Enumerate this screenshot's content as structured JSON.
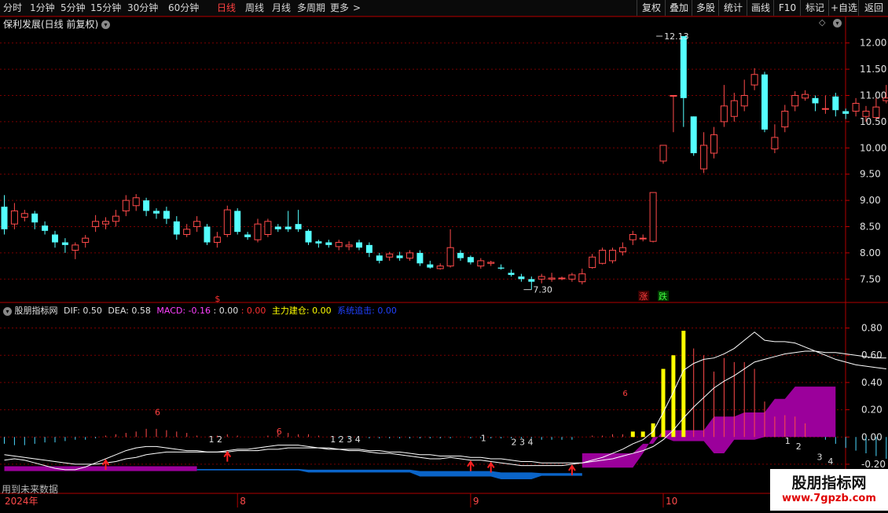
{
  "toolbar": {
    "periods": [
      "分时",
      "1分钟",
      "5分钟",
      "15分钟",
      "30分钟",
      "60分钟",
      "日线",
      "周线",
      "月线",
      "多周期",
      "更多"
    ],
    "active_period": "日线",
    "more_arrow": ">",
    "right_buttons": [
      "复权",
      "叠加",
      "多股",
      "统计",
      "画线",
      "F10",
      "标记",
      "+自选",
      "返回"
    ]
  },
  "main_panel": {
    "title": "保利发展(日线 前复权)",
    "diamond_icon": "◇",
    "high_label": "12.13",
    "low_label": "7.30",
    "signal_s": "$",
    "tag_rise": "涨",
    "tag_fall": "跌"
  },
  "indicator_panel": {
    "name": "股朋指标网",
    "dif_label": "DIF:",
    "dif_value": "0.50",
    "dea_label": "DEA:",
    "dea_value": "0.58",
    "macd_label": "MACD:",
    "macd_value": "-0.16",
    "sep_value_1": ": 0.00",
    "sep_value_2": ": 0.00",
    "build_label": "主力建仓:",
    "build_value": "0.00",
    "chase_label": "系统追击:",
    "chase_value": "0.00",
    "footer_note": "用到未来数据",
    "small_labels": {
      "six_a": "6",
      "six_b": "6",
      "six_c": "6",
      "seq_1": "1 2",
      "seq_2": "1 2 3 4",
      "seq_3": "1",
      "seq_4": "2 3 4",
      "seq_5": "1",
      "seq_6": "2",
      "seq_7": "3",
      "seq_8": "4"
    }
  },
  "x_axis": {
    "year_label": "2024年",
    "months": [
      "8",
      "9",
      "10"
    ]
  },
  "watermark": {
    "title": "股朋指标网",
    "url": "www.7gpzb.com"
  },
  "colors": {
    "background": "#000000",
    "grid": "#7a0000",
    "up_candle": "#ff4a4a",
    "down_candle": "#54ffff",
    "yellow_bar": "#ffff00",
    "purple_band": "#9b009b",
    "blue_band": "#0a64c8",
    "macd_label": "#ff40ff",
    "chase_label": "#2040ff"
  },
  "chart_data": {
    "type": "candlestick",
    "price_axis": {
      "ticks": [
        "12.00",
        "11.50",
        "11.00",
        "10.50",
        "10.00",
        "9.50",
        "9.00",
        "8.50",
        "8.00",
        "7.50"
      ],
      "range": [
        7.1,
        12.25
      ]
    },
    "indicator_axis": {
      "ticks": [
        "0.80",
        "0.60",
        "0.40",
        "0.20",
        "0.00",
        "-0.20"
      ],
      "range": [
        -0.31,
        0.93
      ]
    },
    "candles": [
      [
        8.88,
        8.45,
        9.1,
        8.35
      ],
      [
        8.55,
        8.8,
        8.95,
        8.45
      ],
      [
        8.68,
        8.75,
        8.82,
        8.6
      ],
      [
        8.75,
        8.58,
        8.8,
        8.45
      ],
      [
        8.52,
        8.42,
        8.6,
        8.35
      ],
      [
        8.35,
        8.2,
        8.42,
        8.1
      ],
      [
        8.2,
        8.15,
        8.28,
        8.0
      ],
      [
        8.05,
        8.15,
        8.2,
        7.88
      ],
      [
        8.2,
        8.28,
        8.34,
        8.1
      ],
      [
        8.5,
        8.6,
        8.72,
        8.4
      ],
      [
        8.55,
        8.6,
        8.68,
        8.45
      ],
      [
        8.6,
        8.7,
        8.82,
        8.5
      ],
      [
        8.8,
        9.0,
        9.1,
        8.7
      ],
      [
        8.9,
        9.05,
        9.12,
        8.8
      ],
      [
        9.0,
        8.8,
        9.05,
        8.7
      ],
      [
        8.8,
        8.75,
        8.85,
        8.65
      ],
      [
        8.8,
        8.65,
        8.88,
        8.55
      ],
      [
        8.6,
        8.35,
        8.7,
        8.25
      ],
      [
        8.35,
        8.45,
        8.55,
        8.3
      ],
      [
        8.5,
        8.6,
        8.7,
        8.4
      ],
      [
        8.5,
        8.2,
        8.55,
        8.15
      ],
      [
        8.2,
        8.3,
        8.4,
        8.1
      ],
      [
        8.35,
        8.82,
        8.9,
        8.3
      ],
      [
        8.8,
        8.4,
        8.85,
        8.35
      ],
      [
        8.35,
        8.3,
        8.4,
        8.25
      ],
      [
        8.25,
        8.55,
        8.65,
        8.2
      ],
      [
        8.35,
        8.6,
        8.65,
        8.3
      ],
      [
        8.5,
        8.45,
        8.55,
        8.4
      ],
      [
        8.5,
        8.45,
        8.8,
        8.4
      ],
      [
        8.55,
        8.45,
        8.82,
        8.4
      ],
      [
        8.42,
        8.2,
        8.45,
        8.15
      ],
      [
        8.22,
        8.18,
        8.25,
        8.1
      ],
      [
        8.2,
        8.15,
        8.25,
        8.1
      ],
      [
        8.12,
        8.2,
        8.25,
        8.05
      ],
      [
        8.12,
        8.15,
        8.22,
        8.05
      ],
      [
        8.2,
        8.1,
        8.25,
        8.05
      ],
      [
        8.15,
        8.0,
        8.2,
        7.92
      ],
      [
        7.95,
        7.85,
        8.0,
        7.8
      ],
      [
        7.92,
        7.98,
        8.02,
        7.85
      ],
      [
        7.95,
        7.9,
        8.02,
        7.85
      ],
      [
        7.9,
        8.0,
        8.05,
        7.85
      ],
      [
        8.0,
        7.8,
        8.05,
        7.75
      ],
      [
        7.78,
        7.72,
        7.85,
        7.7
      ],
      [
        7.7,
        7.75,
        7.8,
        7.68
      ],
      [
        7.75,
        8.1,
        8.45,
        7.72
      ],
      [
        8.0,
        7.9,
        8.05,
        7.85
      ],
      [
        7.92,
        7.82,
        7.95,
        7.78
      ],
      [
        7.75,
        7.85,
        7.9,
        7.7
      ],
      [
        7.8,
        7.82,
        7.85,
        7.75
      ],
      [
        7.72,
        7.7,
        7.78,
        7.68
      ],
      [
        7.62,
        7.58,
        7.68,
        7.55
      ],
      [
        7.55,
        7.5,
        7.6,
        7.45
      ],
      [
        7.5,
        7.45,
        7.55,
        7.3
      ],
      [
        7.5,
        7.55,
        7.6,
        7.42
      ],
      [
        7.5,
        7.52,
        7.62,
        7.45
      ],
      [
        7.52,
        7.52,
        7.55,
        7.48
      ],
      [
        7.5,
        7.58,
        7.62,
        7.45
      ],
      [
        7.45,
        7.6,
        7.7,
        7.4
      ],
      [
        7.72,
        7.92,
        7.98,
        7.7
      ],
      [
        7.8,
        8.05,
        8.1,
        7.78
      ],
      [
        7.85,
        8.05,
        8.1,
        7.8
      ],
      [
        8.02,
        8.1,
        8.2,
        7.95
      ],
      [
        8.25,
        8.35,
        8.42,
        8.15
      ],
      [
        8.28,
        8.28,
        8.35,
        8.22
      ],
      [
        8.22,
        9.15,
        9.15,
        8.2
      ],
      [
        9.75,
        10.05,
        10.05,
        9.7
      ],
      [
        11.0,
        11.0,
        11.0,
        10.3
      ],
      [
        12.13,
        10.95,
        12.13,
        10.4
      ],
      [
        10.6,
        9.9,
        10.6,
        9.85
      ],
      [
        9.6,
        10.05,
        10.3,
        9.52
      ],
      [
        9.9,
        10.25,
        10.4,
        9.8
      ],
      [
        10.5,
        10.8,
        11.2,
        10.4
      ],
      [
        10.6,
        10.9,
        11.05,
        10.5
      ],
      [
        10.8,
        11.0,
        11.3,
        10.7
      ],
      [
        11.2,
        11.4,
        11.52,
        11.1
      ],
      [
        11.4,
        10.35,
        11.45,
        10.3
      ],
      [
        9.98,
        10.2,
        10.45,
        9.9
      ],
      [
        10.4,
        10.7,
        10.82,
        10.3
      ],
      [
        10.8,
        11.0,
        11.08,
        10.7
      ],
      [
        10.95,
        11.02,
        11.1,
        10.9
      ],
      [
        10.95,
        10.85,
        11.0,
        10.7
      ],
      [
        10.75,
        10.75,
        11.0,
        10.65
      ],
      [
        10.98,
        10.72,
        11.05,
        10.6
      ],
      [
        10.7,
        10.65,
        10.75,
        10.55
      ],
      [
        10.7,
        10.85,
        10.95,
        10.6
      ],
      [
        10.6,
        10.7,
        10.8,
        10.5
      ],
      [
        10.58,
        10.78,
        10.95,
        10.55
      ],
      [
        10.9,
        10.95,
        11.2,
        10.85
      ]
    ],
    "high_marker": 12.13,
    "low_marker": 7.3
  }
}
